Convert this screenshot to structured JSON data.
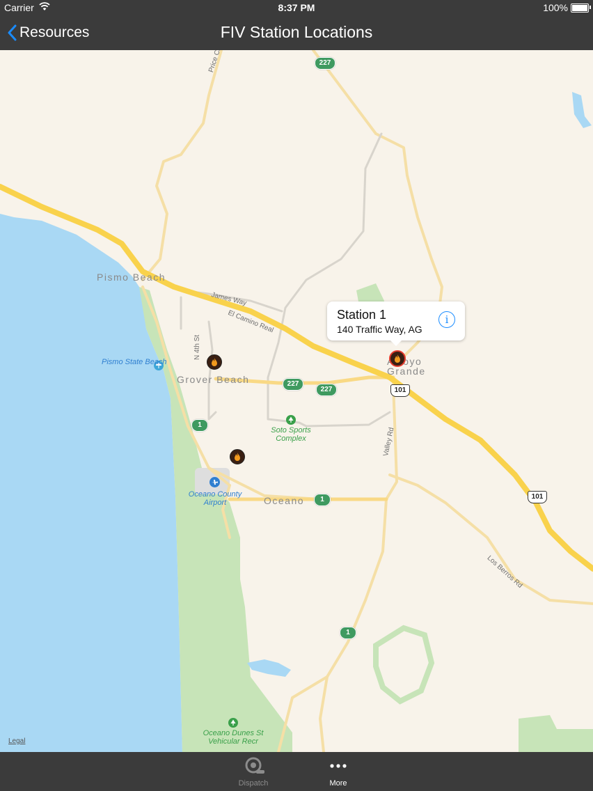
{
  "status_bar": {
    "carrier": "Carrier",
    "time": "8:37 PM",
    "battery": "100%"
  },
  "nav": {
    "back_label": "Resources",
    "title": "FIV Station Locations"
  },
  "map": {
    "towns": [
      "Pismo Beach",
      "Grover Beach",
      "Arroyo Grande",
      "Oceano"
    ],
    "streets": [
      "Price Canyon",
      "James Way",
      "El Camino Real",
      "N 4th St",
      "Valley Rd",
      "Los Berros Rd"
    ],
    "pois": [
      "Pismo State Beach",
      "Soto Sports Complex",
      "Oceano County Airport",
      "Oceano Dunes St Vehicular Recr"
    ],
    "route_shields": [
      "227",
      "227",
      "227",
      "1",
      "1",
      "1",
      "101",
      "101"
    ],
    "colors": {
      "land": "#f8f3ea",
      "water": "#a9d8f4",
      "park": "#c7e4b8",
      "highway": "#f9d24c",
      "road": "#f7dd99",
      "station_pin": "#3a1f12"
    },
    "callout": {
      "title": "Station 1",
      "address": "140 Traffic Way, AG"
    },
    "legal": "Legal"
  },
  "tabs": [
    {
      "label": "Dispatch",
      "icon": "alarm-bell-icon",
      "selected": false
    },
    {
      "label": "More",
      "icon": "more-dots-icon",
      "selected": true
    }
  ]
}
